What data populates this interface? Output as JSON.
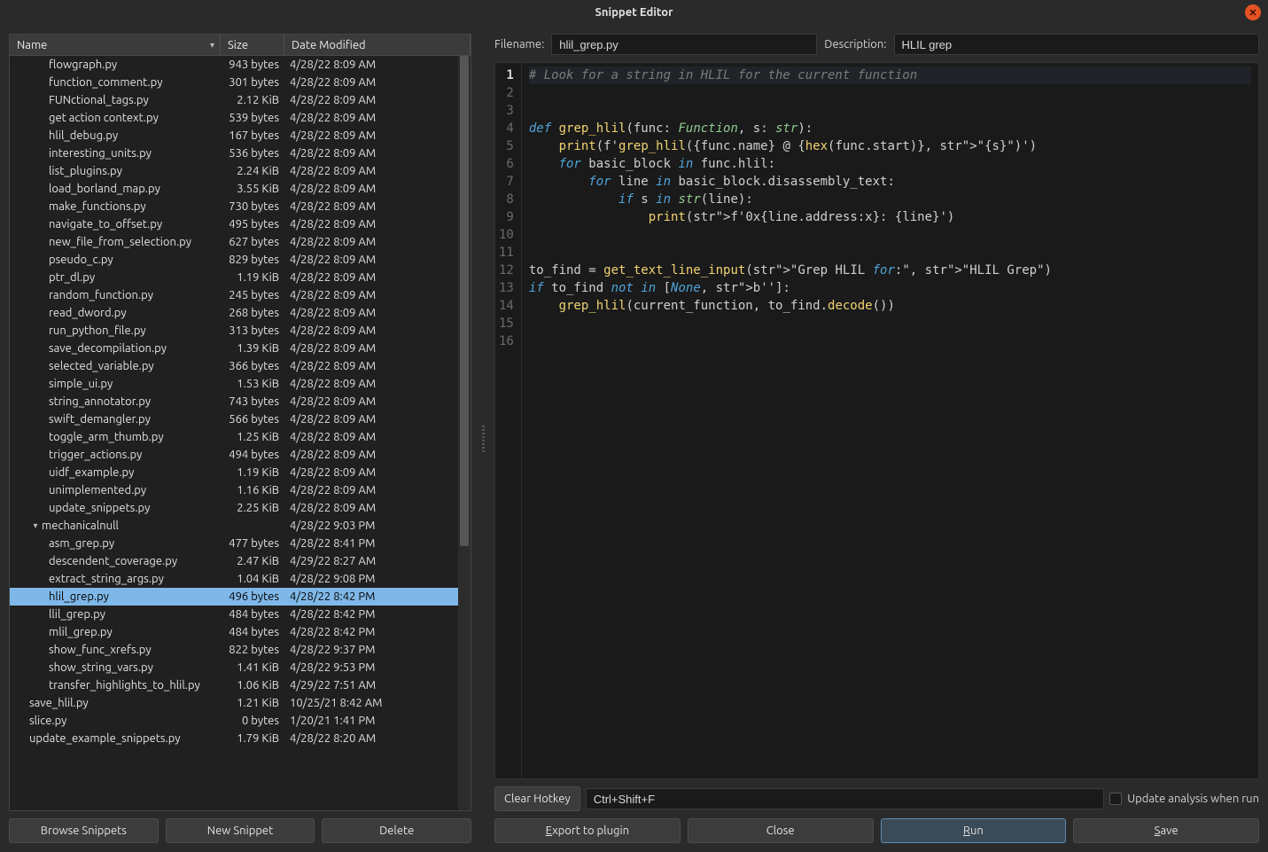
{
  "window": {
    "title": "Snippet Editor"
  },
  "file_table": {
    "columns": {
      "name": "Name",
      "size": "Size",
      "date": "Date Modified"
    },
    "rows": [
      {
        "indent": 2,
        "name": "flowgraph.py",
        "size": "943 bytes",
        "date": "4/28/22 8:09 AM"
      },
      {
        "indent": 2,
        "name": "function_comment.py",
        "size": "301 bytes",
        "date": "4/28/22 8:09 AM"
      },
      {
        "indent": 2,
        "name": "FUNctional_tags.py",
        "size": "2.12 KiB",
        "date": "4/28/22 8:09 AM"
      },
      {
        "indent": 2,
        "name": "get action context.py",
        "size": "539 bytes",
        "date": "4/28/22 8:09 AM"
      },
      {
        "indent": 2,
        "name": "hlil_debug.py",
        "size": "167 bytes",
        "date": "4/28/22 8:09 AM"
      },
      {
        "indent": 2,
        "name": "interesting_units.py",
        "size": "536 bytes",
        "date": "4/28/22 8:09 AM"
      },
      {
        "indent": 2,
        "name": "list_plugins.py",
        "size": "2.24 KiB",
        "date": "4/28/22 8:09 AM"
      },
      {
        "indent": 2,
        "name": "load_borland_map.py",
        "size": "3.55 KiB",
        "date": "4/28/22 8:09 AM"
      },
      {
        "indent": 2,
        "name": "make_functions.py",
        "size": "730 bytes",
        "date": "4/28/22 8:09 AM"
      },
      {
        "indent": 2,
        "name": "navigate_to_offset.py",
        "size": "495 bytes",
        "date": "4/28/22 8:09 AM"
      },
      {
        "indent": 2,
        "name": "new_file_from_selection.py",
        "size": "627 bytes",
        "date": "4/28/22 8:09 AM"
      },
      {
        "indent": 2,
        "name": "pseudo_c.py",
        "size": "829 bytes",
        "date": "4/28/22 8:09 AM"
      },
      {
        "indent": 2,
        "name": "ptr_dl.py",
        "size": "1.19 KiB",
        "date": "4/28/22 8:09 AM"
      },
      {
        "indent": 2,
        "name": "random_function.py",
        "size": "245 bytes",
        "date": "4/28/22 8:09 AM"
      },
      {
        "indent": 2,
        "name": "read_dword.py",
        "size": "268 bytes",
        "date": "4/28/22 8:09 AM"
      },
      {
        "indent": 2,
        "name": "run_python_file.py",
        "size": "313 bytes",
        "date": "4/28/22 8:09 AM"
      },
      {
        "indent": 2,
        "name": "save_decompilation.py",
        "size": "1.39 KiB",
        "date": "4/28/22 8:09 AM"
      },
      {
        "indent": 2,
        "name": "selected_variable.py",
        "size": "366 bytes",
        "date": "4/28/22 8:09 AM"
      },
      {
        "indent": 2,
        "name": "simple_ui.py",
        "size": "1.53 KiB",
        "date": "4/28/22 8:09 AM"
      },
      {
        "indent": 2,
        "name": "string_annotator.py",
        "size": "743 bytes",
        "date": "4/28/22 8:09 AM"
      },
      {
        "indent": 2,
        "name": "swift_demangler.py",
        "size": "566 bytes",
        "date": "4/28/22 8:09 AM"
      },
      {
        "indent": 2,
        "name": "toggle_arm_thumb.py",
        "size": "1.25 KiB",
        "date": "4/28/22 8:09 AM"
      },
      {
        "indent": 2,
        "name": "trigger_actions.py",
        "size": "494 bytes",
        "date": "4/28/22 8:09 AM"
      },
      {
        "indent": 2,
        "name": "uidf_example.py",
        "size": "1.19 KiB",
        "date": "4/28/22 8:09 AM"
      },
      {
        "indent": 2,
        "name": "unimplemented.py",
        "size": "1.16 KiB",
        "date": "4/28/22 8:09 AM"
      },
      {
        "indent": 2,
        "name": "update_snippets.py",
        "size": "2.25 KiB",
        "date": "4/28/22 8:09 AM"
      },
      {
        "indent": 1,
        "name": "mechanicalnull",
        "size": "",
        "date": "4/28/22 9:03 PM",
        "folder": true,
        "expanded": true
      },
      {
        "indent": 2,
        "name": "asm_grep.py",
        "size": "477 bytes",
        "date": "4/28/22 8:41 PM"
      },
      {
        "indent": 2,
        "name": "descendent_coverage.py",
        "size": "2.47 KiB",
        "date": "4/29/22 8:27 AM"
      },
      {
        "indent": 2,
        "name": "extract_string_args.py",
        "size": "1.04 KiB",
        "date": "4/28/22 9:08 PM"
      },
      {
        "indent": 2,
        "name": "hlil_grep.py",
        "size": "496 bytes",
        "date": "4/28/22 8:42 PM",
        "selected": true
      },
      {
        "indent": 2,
        "name": "llil_grep.py",
        "size": "484 bytes",
        "date": "4/28/22 8:42 PM"
      },
      {
        "indent": 2,
        "name": "mlil_grep.py",
        "size": "484 bytes",
        "date": "4/28/22 8:42 PM"
      },
      {
        "indent": 2,
        "name": "show_func_xrefs.py",
        "size": "822 bytes",
        "date": "4/28/22 9:37 PM"
      },
      {
        "indent": 2,
        "name": "show_string_vars.py",
        "size": "1.41 KiB",
        "date": "4/28/22 9:53 PM"
      },
      {
        "indent": 2,
        "name": "transfer_highlights_to_hlil.py",
        "size": "1.06 KiB",
        "date": "4/29/22 7:51 AM"
      },
      {
        "indent": 1,
        "name": "save_hlil.py",
        "size": "1.21 KiB",
        "date": "10/25/21 8:42 AM"
      },
      {
        "indent": 1,
        "name": "slice.py",
        "size": "0 bytes",
        "date": "1/20/21 1:41 PM"
      },
      {
        "indent": 1,
        "name": "update_example_snippets.py",
        "size": "1.79 KiB",
        "date": "4/28/22 8:20 AM"
      }
    ]
  },
  "left_buttons": {
    "browse": "Browse Snippets",
    "new": "New Snippet",
    "delete": "Delete"
  },
  "filename": {
    "label": "Filename:",
    "value": "hlil_grep.py"
  },
  "description": {
    "label": "Description:",
    "value": "HLIL grep"
  },
  "code": {
    "line_count": 16,
    "current_line": 1,
    "lines_raw": [
      "# Look for a string in HLIL for the current function",
      "",
      "",
      "def grep_hlil(func: Function, s: str):",
      "    print(f'grep_hlil({func.name} @ {hex(func.start)}, \"{s}\")')",
      "    for basic_block in func.hlil:",
      "        for line in basic_block.disassembly_text:",
      "            if s in str(line):",
      "                print(f'0x{line.address:x}: {line}')",
      "",
      "",
      "to_find = get_text_line_input(\"Grep HLIL for:\", \"HLIL Grep\")",
      "if to_find not in [None, b'']:",
      "    grep_hlil(current_function, to_find.decode())",
      "",
      ""
    ]
  },
  "hotkey": {
    "label": "Clear Hotkey",
    "value": "Ctrl+Shift+F"
  },
  "update_checkbox": {
    "label": "Update analysis when run",
    "checked": false
  },
  "right_buttons": {
    "export": "Export to plugin",
    "close": "Close",
    "run": "Run",
    "save": "Save"
  }
}
